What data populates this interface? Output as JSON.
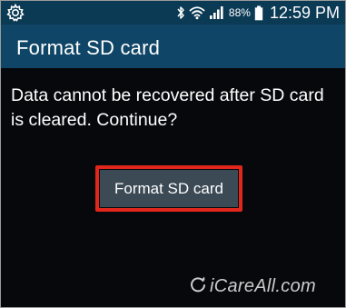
{
  "status_bar": {
    "left_icon": "settings-gear-icon",
    "icons": [
      "bluetooth-icon",
      "wifi-icon",
      "signal-icon"
    ],
    "battery_percent": "88%",
    "battery_icon": "battery-icon",
    "time": "12:59 PM"
  },
  "dialog": {
    "title": "Format SD card",
    "message": "Data cannot be recovered after SD card is cleared. Continue?",
    "button_label": "Format SD card"
  },
  "watermark": {
    "text": "iCareAll.com",
    "icon": "refresh-logo-icon"
  },
  "colors": {
    "status_bar_bg": "#0b3a55",
    "header_bg": "#0f4566",
    "body_bg": "#06080c",
    "button_bg": "#3c4a55",
    "highlight_border": "#e1261c",
    "text": "#ffffff"
  }
}
